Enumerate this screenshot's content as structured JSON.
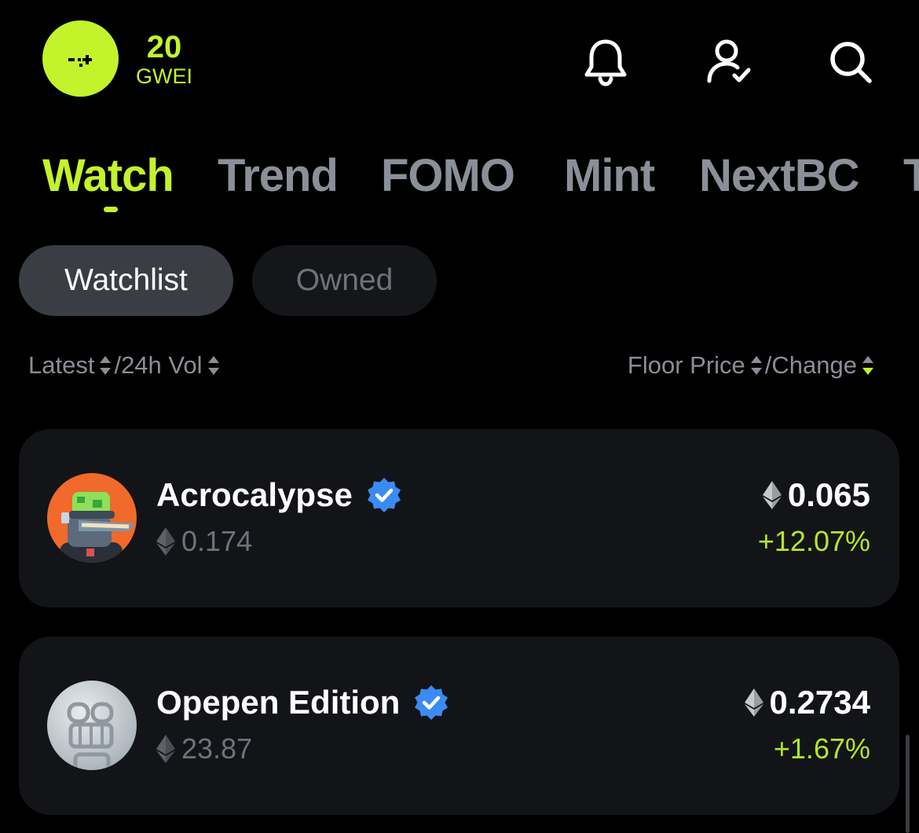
{
  "header": {
    "gas_value": "20",
    "gas_unit": "GWEI",
    "icons": [
      "bell-icon",
      "user-check-icon",
      "search-icon"
    ]
  },
  "main_tabs": [
    "Watch",
    "Trend",
    "FOMO",
    "Mint",
    "NextBC",
    "T"
  ],
  "active_tab": "Watch",
  "segments": {
    "watchlist": "Watchlist",
    "owned": "Owned",
    "active": "Watchlist"
  },
  "sort": {
    "latest": "Latest",
    "vol": "/24h Vol",
    "floor_price": "Floor Price",
    "change": "/Change"
  },
  "collections": [
    {
      "name": "Acrocalypse",
      "verified": true,
      "volume": "0.174",
      "floor_price": "0.065",
      "change": "+12.07%"
    },
    {
      "name": "Opepen Edition",
      "verified": true,
      "volume": "23.87",
      "floor_price": "0.2734",
      "change": "+1.67%"
    }
  ],
  "colors": {
    "accent": "#c3f32b",
    "positive": "#b4e62a",
    "verified": "#3b8bf5",
    "card_bg": "#131418"
  }
}
